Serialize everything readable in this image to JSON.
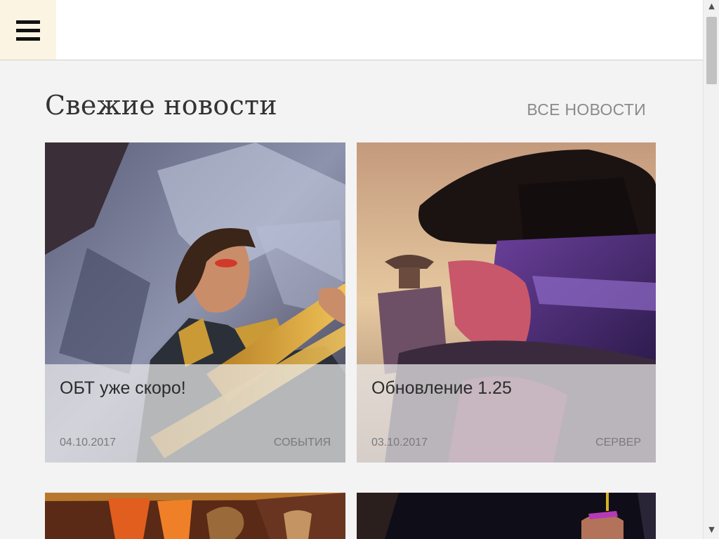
{
  "header": {
    "menu_icon": "hamburger-menu-icon"
  },
  "news": {
    "section_title": "Свежие новости",
    "all_news_label": "ВСЕ НОВОСТИ",
    "cards": [
      {
        "title": "ОБТ уже скоро!",
        "date": "04.10.2017",
        "category": "СОБЫТИЯ"
      },
      {
        "title": "Обновление 1.25",
        "date": "03.10.2017",
        "category": "СЕРВЕР"
      },
      {
        "title": "",
        "date": "",
        "category": ""
      },
      {
        "title": "",
        "date": "",
        "category": ""
      }
    ]
  },
  "scrollbar": {
    "up_arrow": "▲",
    "down_arrow": "▼"
  }
}
